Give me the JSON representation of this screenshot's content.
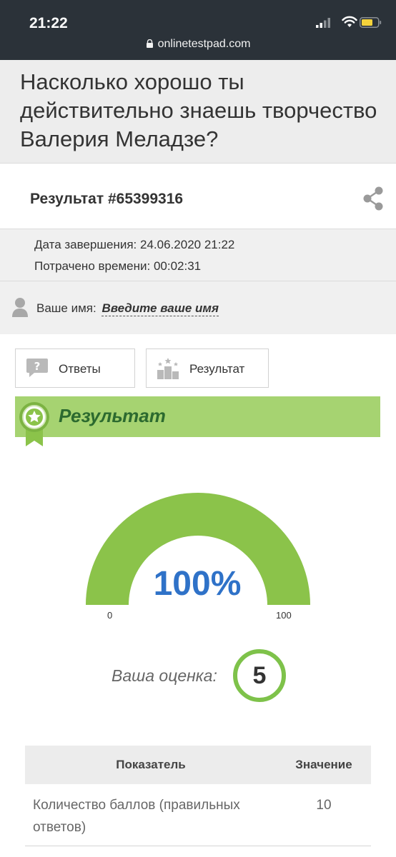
{
  "status_bar": {
    "time": "21:22",
    "url": "onlinetestpad.com"
  },
  "page": {
    "title": "Насколько хорошо ты действительно знаешь творчество Валерия Меладзе?"
  },
  "result": {
    "id_label": "Результат #65399316",
    "completion_label": "Дата завершения:",
    "completion_value": "24.06.2020 21:22",
    "time_spent_label": "Потрачено времени:",
    "time_spent_value": "00:02:31",
    "name_label": "Ваше имя:",
    "name_placeholder": "Введите ваше имя"
  },
  "tabs": [
    {
      "label": "Ответы",
      "icon": "question-bubble-icon"
    },
    {
      "label": "Результат",
      "icon": "podium-icon"
    }
  ],
  "banner": {
    "title": "Результат",
    "icon": "award-badge-icon"
  },
  "gauge": {
    "value_text": "100%",
    "value": 100,
    "min": "0",
    "max": "100",
    "color": "#8bc34a"
  },
  "grade": {
    "label": "Ваша оценка:",
    "value": "5"
  },
  "table": {
    "headers": [
      "Показатель",
      "Значение"
    ],
    "rows": [
      {
        "metric": "Количество баллов (правильных ответов)",
        "value": "10"
      }
    ]
  },
  "colors": {
    "status_bar": "#2b3239",
    "banner_bg": "#a6d371",
    "banner_text": "#2c6a2f",
    "gauge_value": "#2f72c8",
    "grade_ring": "#7ec24a"
  }
}
